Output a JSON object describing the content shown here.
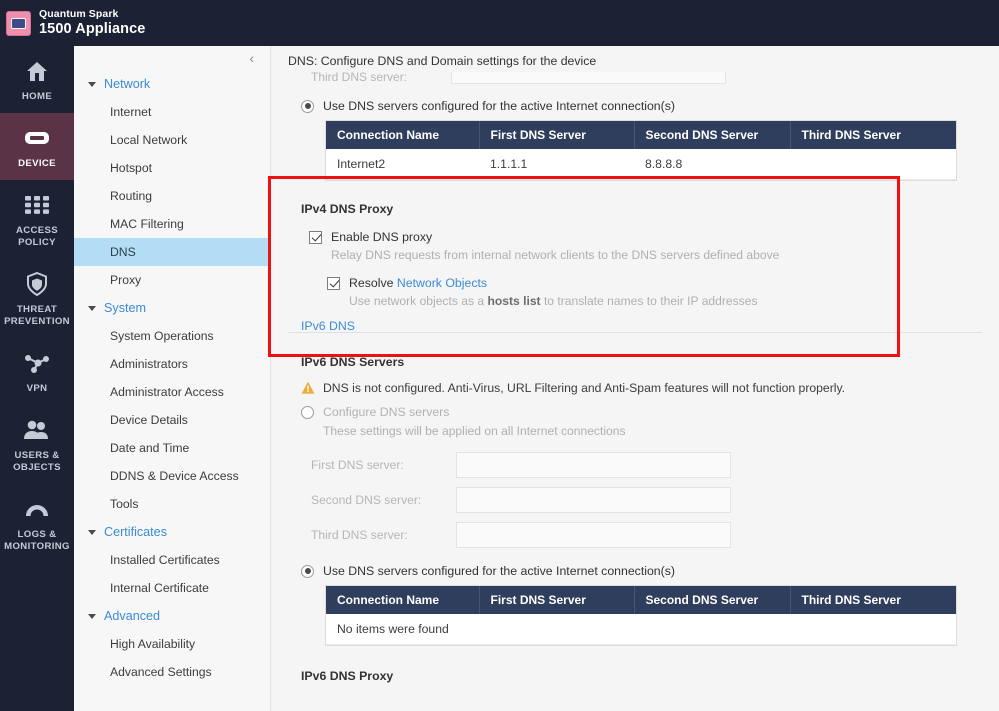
{
  "header": {
    "brand_line1": "Quantum Spark",
    "brand_line2": "1500 Appliance",
    "logo_icon": "appliance-logo-icon"
  },
  "rail": {
    "items": [
      {
        "label": "HOME",
        "icon": "home-icon",
        "active": false
      },
      {
        "label": "DEVICE",
        "icon": "device-icon",
        "active": true
      },
      {
        "label": "ACCESS\nPOLICY",
        "icon": "grid-icon",
        "active": false
      },
      {
        "label": "THREAT\nPREVENTION",
        "icon": "shield-icon",
        "active": false
      },
      {
        "label": "VPN",
        "icon": "network-nodes-icon",
        "active": false
      },
      {
        "label": "USERS &\nOBJECTS",
        "icon": "users-icon",
        "active": false
      },
      {
        "label": "LOGS &\nMONITORING",
        "icon": "gauge-icon",
        "active": false
      }
    ]
  },
  "nav": {
    "collapse_icon": "chevron-left-icon",
    "groups": [
      {
        "label": "Network",
        "items": [
          {
            "label": "Internet",
            "selected": false
          },
          {
            "label": "Local Network",
            "selected": false
          },
          {
            "label": "Hotspot",
            "selected": false
          },
          {
            "label": "Routing",
            "selected": false
          },
          {
            "label": "MAC Filtering",
            "selected": false
          },
          {
            "label": "DNS",
            "selected": true
          },
          {
            "label": "Proxy",
            "selected": false
          }
        ]
      },
      {
        "label": "System",
        "items": [
          {
            "label": "System Operations",
            "selected": false
          },
          {
            "label": "Administrators",
            "selected": false
          },
          {
            "label": "Administrator Access",
            "selected": false
          },
          {
            "label": "Device Details",
            "selected": false
          },
          {
            "label": "Date and Time",
            "selected": false
          },
          {
            "label": "DDNS & Device Access",
            "selected": false
          },
          {
            "label": "Tools",
            "selected": false
          }
        ]
      },
      {
        "label": "Certificates",
        "items": [
          {
            "label": "Installed Certificates",
            "selected": false
          },
          {
            "label": "Internal Certificate",
            "selected": false
          }
        ]
      },
      {
        "label": "Advanced",
        "items": [
          {
            "label": "High Availability",
            "selected": false
          },
          {
            "label": "Advanced Settings",
            "selected": false
          }
        ]
      }
    ]
  },
  "main": {
    "page_header": "DNS: Configure DNS and Domain settings for the device",
    "clipped_field_label": "Third DNS server:",
    "ipv4": {
      "use_active_radio_label": "Use DNS servers configured for the active Internet connection(s)",
      "use_active_radio_selected": true,
      "table": {
        "columns": [
          "Connection Name",
          "First DNS Server",
          "Second DNS Server",
          "Third DNS Server"
        ],
        "rows": [
          [
            "Internet2",
            "1.1.1.1",
            "8.8.8.8",
            ""
          ]
        ]
      },
      "proxy": {
        "title": "IPv4 DNS Proxy",
        "enable_label": "Enable DNS proxy",
        "enable_checked": true,
        "enable_help": "Relay DNS requests from internal network clients to the DNS servers defined above",
        "resolve_label_prefix": "Resolve ",
        "resolve_link": "Network Objects",
        "resolve_checked": true,
        "resolve_help_pre": "Use network objects as a ",
        "resolve_help_bold": "hosts list",
        "resolve_help_post": " to translate names to their IP addresses"
      }
    },
    "ipv6": {
      "section_link": "IPv6 DNS",
      "servers_title": "IPv6 DNS Servers",
      "warning_icon": "warning-triangle-icon",
      "warning_text": "DNS is not configured. Anti-Virus, URL Filtering and Anti-Spam features will not function properly.",
      "configure_radio_label": "Configure DNS servers",
      "configure_radio_selected": false,
      "configure_note": "These settings will be applied on all Internet connections",
      "fields": [
        {
          "label": "First DNS server:",
          "value": ""
        },
        {
          "label": "Second DNS server:",
          "value": ""
        },
        {
          "label": "Third DNS server:",
          "value": ""
        }
      ],
      "use_active_radio_label": "Use DNS servers configured for the active Internet connection(s)",
      "use_active_radio_selected": true,
      "table": {
        "columns": [
          "Connection Name",
          "First DNS Server",
          "Second DNS Server",
          "Third DNS Server"
        ],
        "empty_message": "No items were found"
      },
      "proxy_title": "IPv6 DNS Proxy"
    }
  },
  "colors": {
    "topbar": "#1c2233",
    "rail_active": "#5b3347",
    "nav_selected": "#b3ddf5",
    "table_header": "#2e3e5c",
    "link": "#3a8bd6",
    "annotation": "#ee1111",
    "warning": "#f0ab34",
    "logo": "#ef8fae"
  }
}
